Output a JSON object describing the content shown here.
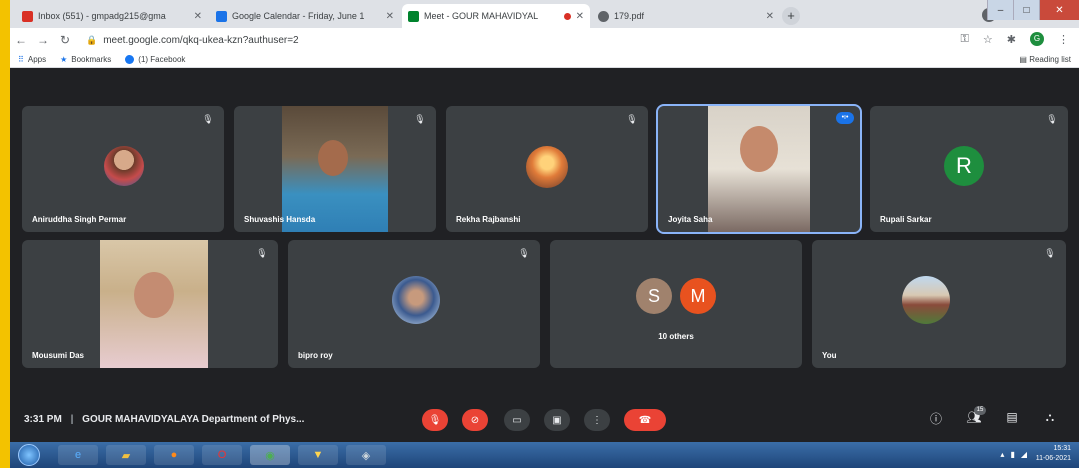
{
  "browser": {
    "tabs": [
      {
        "label": "Inbox (551) - gmpadg215@gma",
        "active": false,
        "favicon_color": "#d93025"
      },
      {
        "label": "Google Calendar - Friday, June 1",
        "active": false,
        "favicon_color": "#1a73e8"
      },
      {
        "label": "Meet - GOUR MAHAVIDYAL",
        "active": true,
        "favicon_color": "#00832d"
      },
      {
        "label": "179.pdf",
        "active": false,
        "favicon_color": "#5f6368"
      }
    ],
    "new_tab": "+",
    "url": "meet.google.com/qkq-ukea-kzn?authuser=2",
    "bookmarks": [
      {
        "label": "Apps",
        "icon": "apps-grid-icon"
      },
      {
        "label": "Bookmarks",
        "icon": "star-icon"
      },
      {
        "label": "(1) Facebook",
        "icon": "facebook-icon"
      }
    ],
    "reading_list": "Reading list",
    "profile_initial": "G"
  },
  "participants_row1": [
    {
      "name": "Aniruddha Singh Permar",
      "kind": "avatar",
      "muted": true
    },
    {
      "name": "Shuvashis Hansda",
      "kind": "video",
      "muted": true
    },
    {
      "name": "Rekha Rajbanshi",
      "kind": "avatar",
      "muted": true
    },
    {
      "name": "Joyita Saha",
      "kind": "video",
      "speaking": true
    },
    {
      "name": "Rupali Sarkar",
      "kind": "letter",
      "letter": "R",
      "color": "#1e8e3e",
      "muted": true
    }
  ],
  "participants_row2": [
    {
      "name": "Mousumi Das",
      "kind": "video",
      "muted": true
    },
    {
      "name": "bipro roy",
      "kind": "avatar",
      "muted": true
    },
    {
      "name": "10 others",
      "kind": "group",
      "letters": [
        "S",
        "M"
      ],
      "colors": [
        "#a0826d",
        "#e8521f"
      ]
    },
    {
      "name": "You",
      "kind": "avatar",
      "muted": true
    }
  ],
  "meeting": {
    "time": "3:31 PM",
    "separator": "|",
    "title": "GOUR MAHAVIDYALAYA Department of Phys...",
    "people_count": "15"
  },
  "taskbar": {
    "time": "15:31",
    "date": "11-06-2021"
  },
  "colors": {
    "meet_bg": "#202124",
    "tile_bg": "#3c4043",
    "danger": "#ea4335",
    "accent": "#8ab4f8",
    "frame": "#f3c200"
  }
}
